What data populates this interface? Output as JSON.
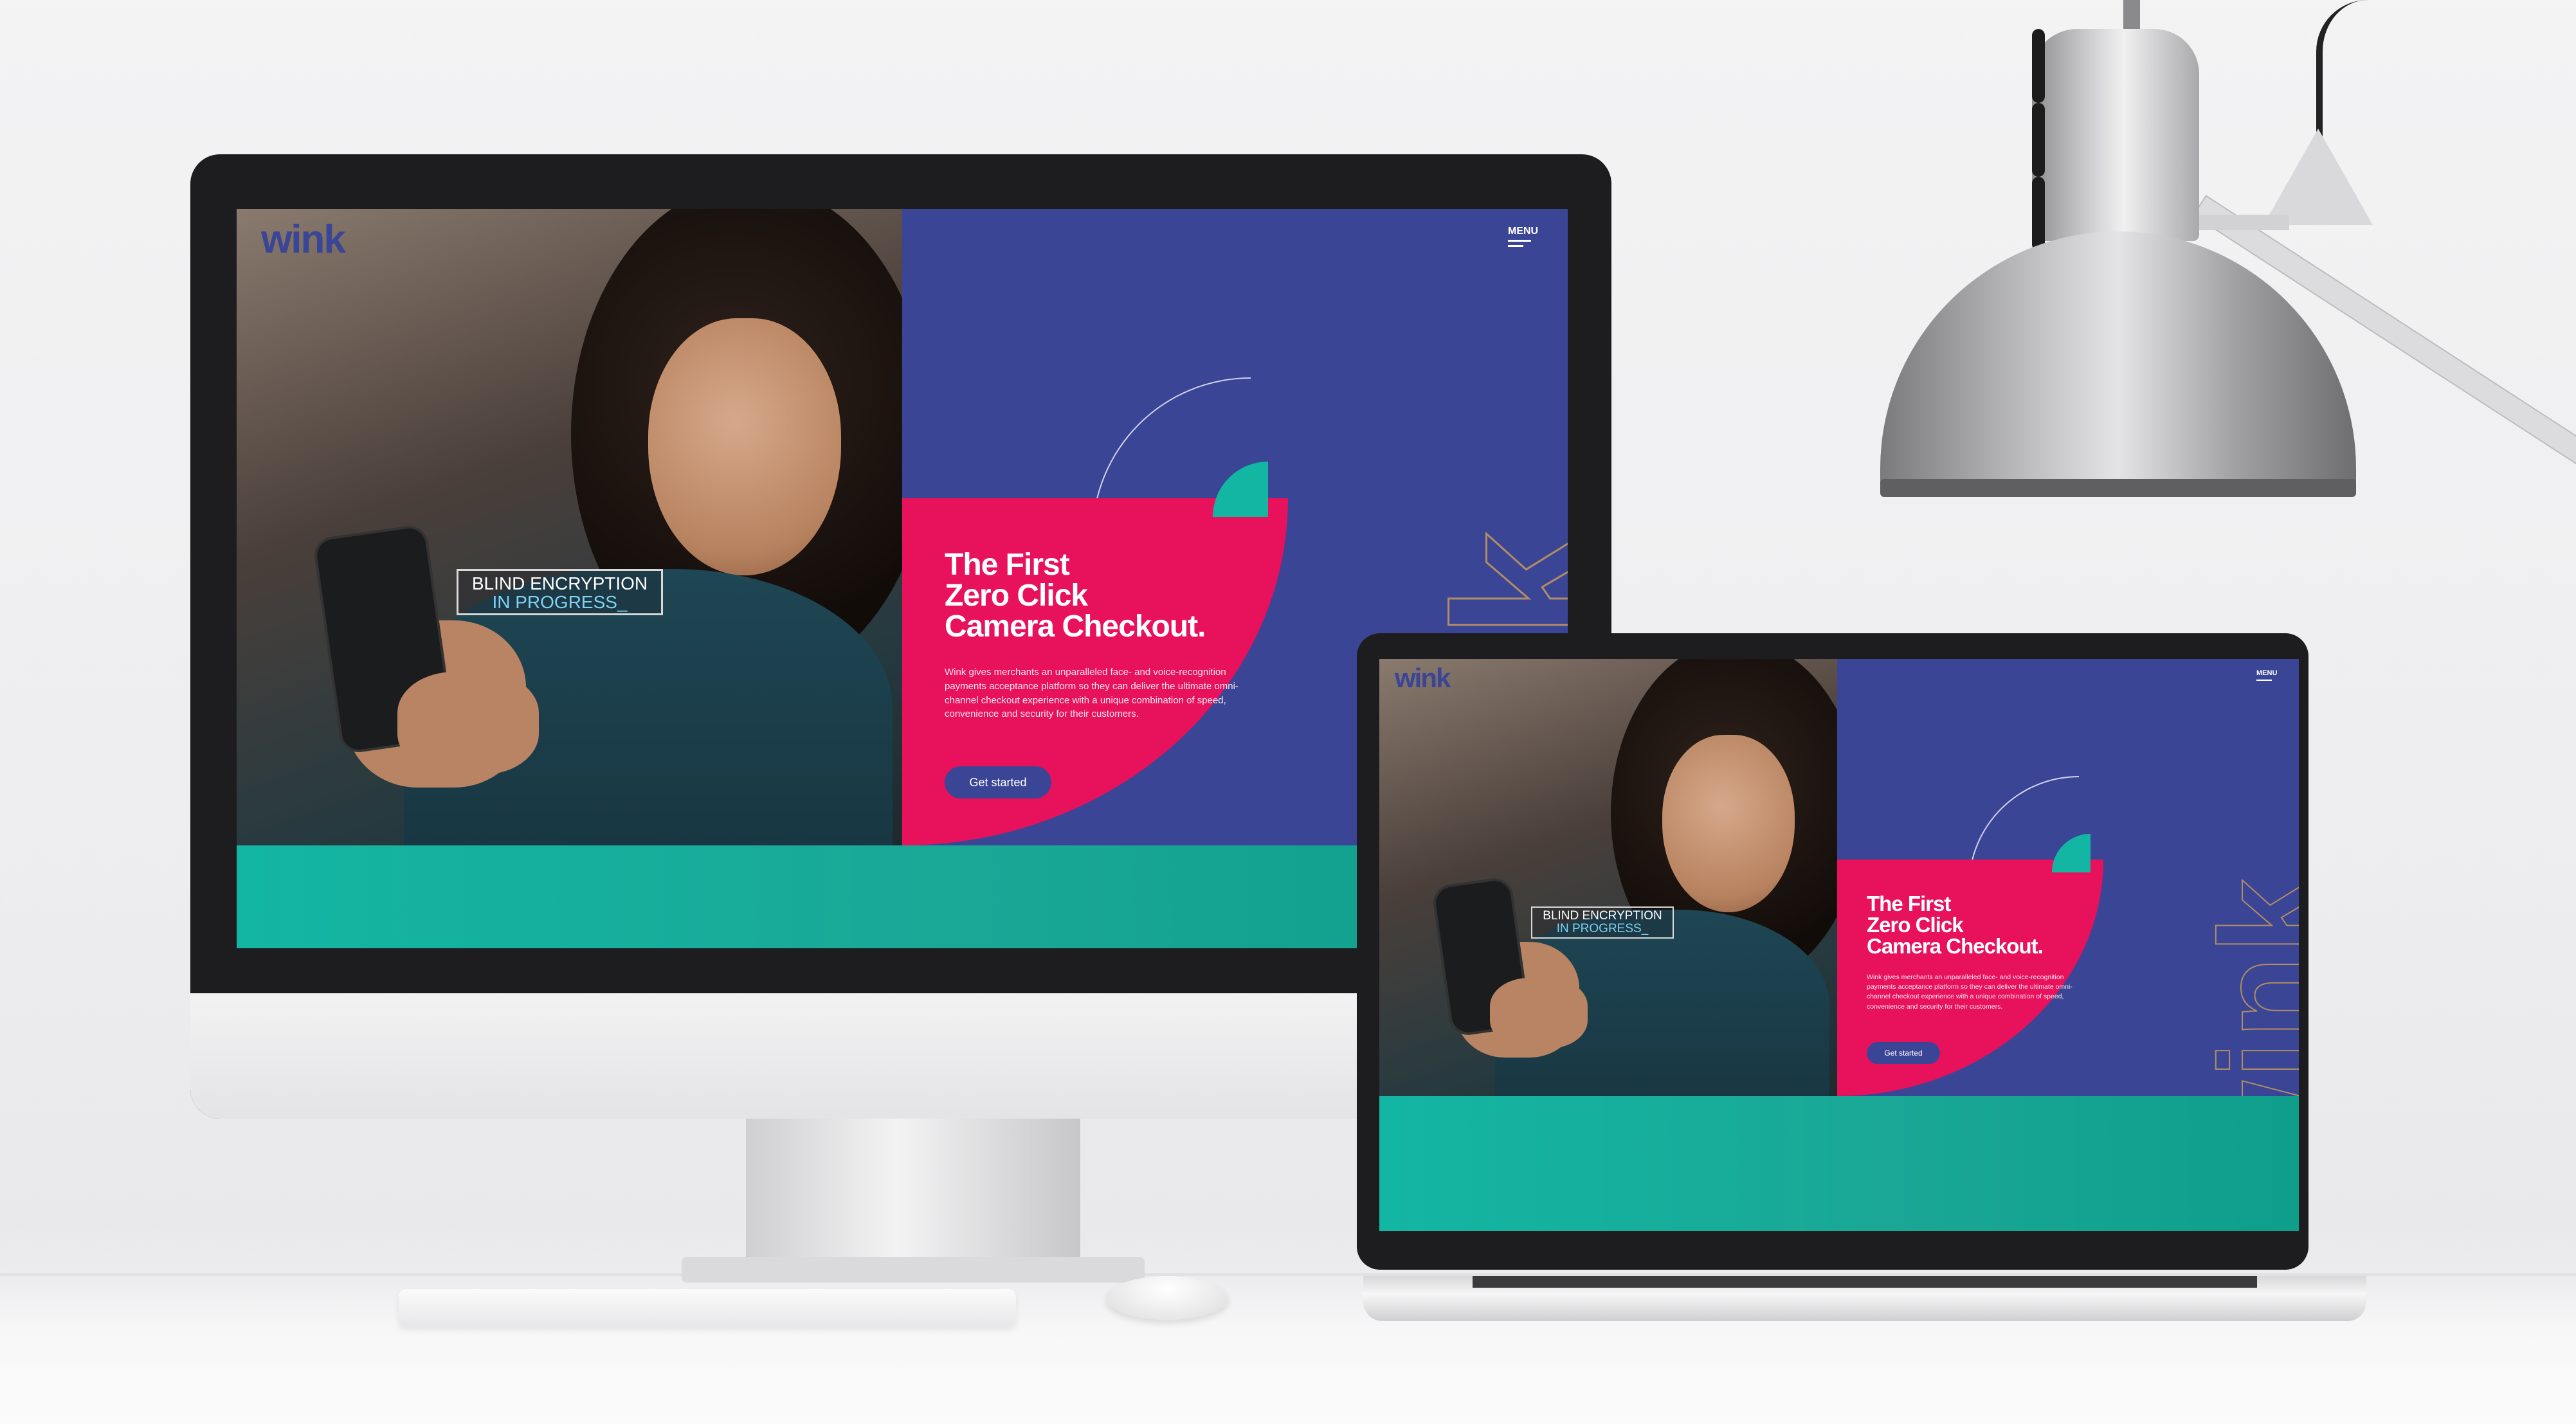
{
  "site": {
    "logo": "wink",
    "watermark": "wink",
    "menu_label": "MENU",
    "badge_line1": "BLIND ENCRYPTION",
    "badge_line2": "IN PROGRESS_",
    "hero_title_line1": "The First",
    "hero_title_line2": "Zero Click",
    "hero_title_line3": "Camera Checkout.",
    "hero_body": "Wink gives merchants an unparalleled face- and voice-recognition payments acceptance platform so they can deliver the ultimate omni-channel checkout experience with a unique combination of speed, convenience and security for their customers.",
    "cta_label": "Get started"
  },
  "colors": {
    "brand_blue": "#3b4596",
    "brand_pink": "#e8125c",
    "brand_teal": "#13b6a3",
    "accent_gold": "#c79a5c"
  }
}
